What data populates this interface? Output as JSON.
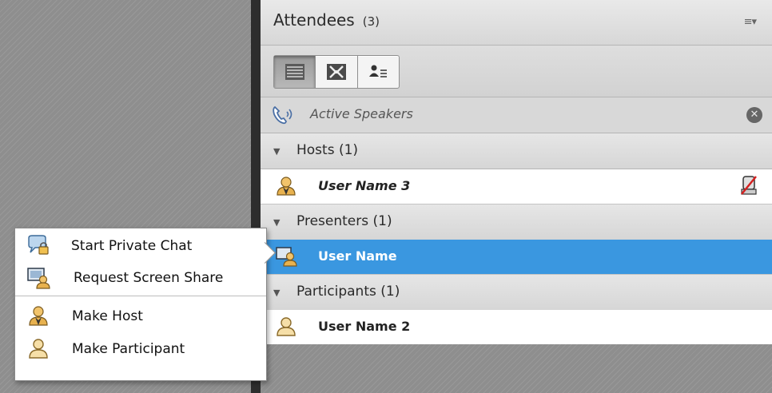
{
  "panel": {
    "title": "Attendees",
    "count": "(3)",
    "menu_icon": "≡▾"
  },
  "toolbar": {
    "views": [
      "list-view-icon",
      "breakout-view-icon",
      "status-view-icon"
    ]
  },
  "speakers": {
    "label": "Active Speakers",
    "close_icon": "close-circle-icon"
  },
  "sections": {
    "hosts": {
      "label": "Hosts (1)"
    },
    "presenters": {
      "label": "Presenters (1)"
    },
    "participants": {
      "label": "Participants (1)"
    }
  },
  "users": {
    "host": {
      "name": "User Name 3",
      "icon": "host-icon",
      "status": "mic-muted-icon"
    },
    "presenter": {
      "name": "User Name",
      "icon": "presenter-icon"
    },
    "participant": {
      "name": "User Name 2",
      "icon": "participant-icon"
    }
  },
  "context_menu": {
    "items": [
      {
        "label": "Start Private Chat",
        "icon": "private-chat-icon"
      },
      {
        "label": "Request Screen Share",
        "icon": "screen-share-icon"
      },
      {
        "label": "Make Host",
        "icon": "host-icon"
      },
      {
        "label": "Make Participant",
        "icon": "participant-icon"
      }
    ]
  },
  "colors": {
    "selection": "#3a97e0",
    "divider": "#2d2d2d",
    "background_hatch": "#8e8e8e"
  }
}
